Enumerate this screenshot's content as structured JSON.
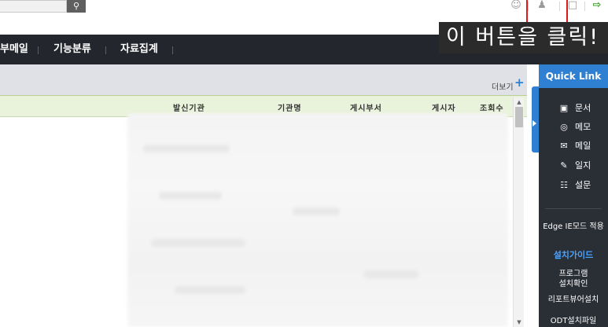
{
  "topbar": {
    "search_icon": "search-icon",
    "icons": [
      "user-circle-icon",
      "settings-user-icon",
      "memo-icon",
      "logout-icon"
    ]
  },
  "annotation": {
    "label": "이 버튼을 클릭!"
  },
  "nav": {
    "items": [
      "부메일",
      "기능분류",
      "자료집계"
    ]
  },
  "content": {
    "more_label": "더보기",
    "more_plus": "+",
    "columns": [
      "발신기관",
      "기관명",
      "게시부서",
      "게시자",
      "조회수"
    ]
  },
  "quicklink": {
    "title": "Quick Link",
    "items": [
      {
        "icon": "document-icon",
        "glyph": "▣",
        "label": "문서"
      },
      {
        "icon": "memo-bubble-icon",
        "glyph": "◎",
        "label": "메모"
      },
      {
        "icon": "mail-icon",
        "glyph": "✉",
        "label": "메일"
      },
      {
        "icon": "journal-icon",
        "glyph": "✎",
        "label": "일지"
      },
      {
        "icon": "survey-icon",
        "glyph": "☷",
        "label": "설문"
      }
    ],
    "edge_mode": "Edge IE모드 적용",
    "install_guide": "설치가이드",
    "program_line1": "프로그램",
    "program_line2": "설치확인",
    "report_viewer": "리포트뷰어설치",
    "odt": "ODT설치파일"
  },
  "colors": {
    "nav_bg": "#23272d",
    "accent_blue": "#2f7fd3",
    "annotation_red": "#e01818",
    "table_header_bg": "#e9f2da"
  }
}
